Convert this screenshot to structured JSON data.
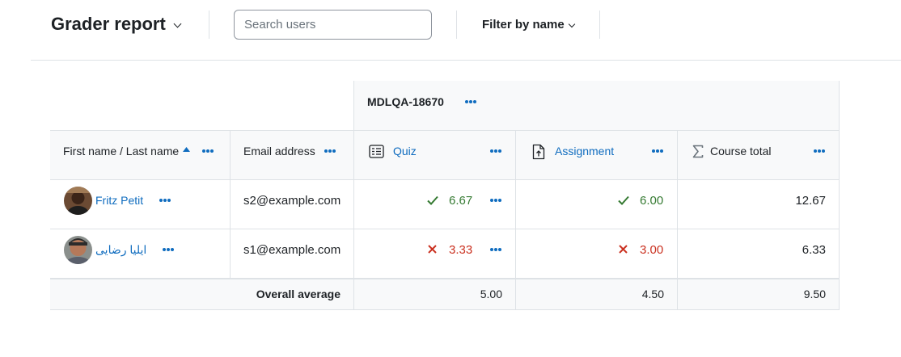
{
  "header": {
    "title": "Grader report",
    "search_placeholder": "Search users",
    "filter_label": "Filter by name"
  },
  "table": {
    "category_name": "MDLQA-18670",
    "columns": {
      "name": "First name / Last name",
      "email": "Email address",
      "quiz": "Quiz",
      "assignment": "Assignment",
      "total": "Course total"
    },
    "rows": [
      {
        "name": "Fritz Petit",
        "email": "s2@example.com",
        "quiz": "6.67",
        "quiz_status": "pass",
        "assignment": "6.00",
        "assignment_status": "pass",
        "total": "12.67"
      },
      {
        "name": "ایلیا رضایی",
        "email": "s1@example.com",
        "quiz": "3.33",
        "quiz_status": "fail",
        "assignment": "3.00",
        "assignment_status": "fail",
        "total": "6.33"
      }
    ],
    "average": {
      "label": "Overall average",
      "quiz": "5.00",
      "assignment": "4.50",
      "total": "9.50"
    }
  },
  "colors": {
    "link": "#0f6cbf",
    "pass": "#357a32",
    "fail": "#ca3120",
    "header_bg": "#f8f9fa",
    "border": "#dee2e6"
  },
  "icons": {
    "sort": "caret-up-icon",
    "quiz": "quiz-icon",
    "assignment": "assignment-icon",
    "total": "sigma-icon",
    "pass": "check-icon",
    "fail": "cross-icon",
    "menu": "more-actions-icon"
  }
}
